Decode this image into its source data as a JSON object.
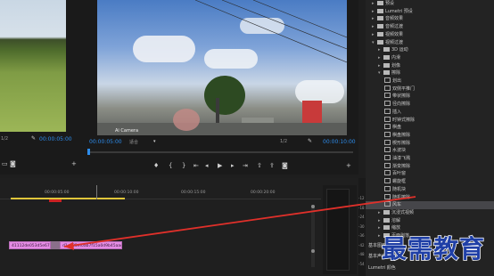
{
  "left_monitor": {
    "scale": "1/2",
    "timecode": "00:00:05:00"
  },
  "program_monitor": {
    "watermark": "Ai Camera",
    "timecode_left": "00:00:05:00",
    "fit_label": "适合",
    "scale": "1/2",
    "timecode_right": "00:00:10:00"
  },
  "timeline": {
    "ruler": [
      "00:00:05:00",
      "00:00:10:00",
      "00:00:15:00",
      "00:00:20:00"
    ],
    "clip1_label": "41112de053d5e67",
    "clip2_label": "d1ce85ef0ab7f15a0d9b45aac9b",
    "meter_labels": [
      "-12",
      "-18",
      "-24",
      "-30",
      "-36",
      "-42",
      "-48",
      "-54"
    ]
  },
  "effects": {
    "items": [
      {
        "kind": "folder",
        "indent": 1,
        "label": "预设"
      },
      {
        "kind": "folder",
        "indent": 1,
        "label": "Lumetri 预设"
      },
      {
        "kind": "folder",
        "indent": 1,
        "label": "音频效果"
      },
      {
        "kind": "folder",
        "indent": 1,
        "label": "音频过渡"
      },
      {
        "kind": "folder",
        "indent": 1,
        "label": "视频效果"
      },
      {
        "kind": "folder",
        "indent": 1,
        "label": "视频过渡",
        "open": true
      },
      {
        "kind": "folder",
        "indent": 2,
        "label": "3D 运动"
      },
      {
        "kind": "folder",
        "indent": 2,
        "label": "内滑"
      },
      {
        "kind": "folder",
        "indent": 2,
        "label": "划像"
      },
      {
        "kind": "folder",
        "indent": 2,
        "label": "擦除",
        "open": true
      },
      {
        "kind": "fx",
        "indent": 3,
        "label": "划出"
      },
      {
        "kind": "fx",
        "indent": 3,
        "label": "双侧平推门"
      },
      {
        "kind": "fx",
        "indent": 3,
        "label": "带状擦除"
      },
      {
        "kind": "fx",
        "indent": 3,
        "label": "径向擦除"
      },
      {
        "kind": "fx",
        "indent": 3,
        "label": "插入"
      },
      {
        "kind": "fx",
        "indent": 3,
        "label": "时钟式擦除"
      },
      {
        "kind": "fx",
        "indent": 3,
        "label": "棋盘"
      },
      {
        "kind": "fx",
        "indent": 3,
        "label": "棋盘擦除"
      },
      {
        "kind": "fx",
        "indent": 3,
        "label": "楔形擦除"
      },
      {
        "kind": "fx",
        "indent": 3,
        "label": "水波块"
      },
      {
        "kind": "fx",
        "indent": 3,
        "label": "油漆飞溅"
      },
      {
        "kind": "fx",
        "indent": 3,
        "label": "渐变擦除"
      },
      {
        "kind": "fx",
        "indent": 3,
        "label": "百叶窗"
      },
      {
        "kind": "fx",
        "indent": 3,
        "label": "螺旋框"
      },
      {
        "kind": "fx",
        "indent": 3,
        "label": "随机块"
      },
      {
        "kind": "fx",
        "indent": 3,
        "label": "随机擦除"
      },
      {
        "kind": "fx",
        "indent": 3,
        "label": "风车",
        "selected": true
      },
      {
        "kind": "folder",
        "indent": 2,
        "label": "沉浸式视频"
      },
      {
        "kind": "folder",
        "indent": 2,
        "label": "溶解"
      },
      {
        "kind": "folder",
        "indent": 2,
        "label": "缩放"
      },
      {
        "kind": "folder",
        "indent": 2,
        "label": "页面剥落"
      }
    ],
    "bottom_tabs": [
      "基本图形",
      "基本声音",
      "Lumetri 颜色"
    ]
  },
  "overlay_text": "最需教育",
  "colors": {
    "timecode": "#2d8ceb",
    "clip": "#e58ce5",
    "arrow": "#e0302a",
    "selected": "#46464a"
  }
}
